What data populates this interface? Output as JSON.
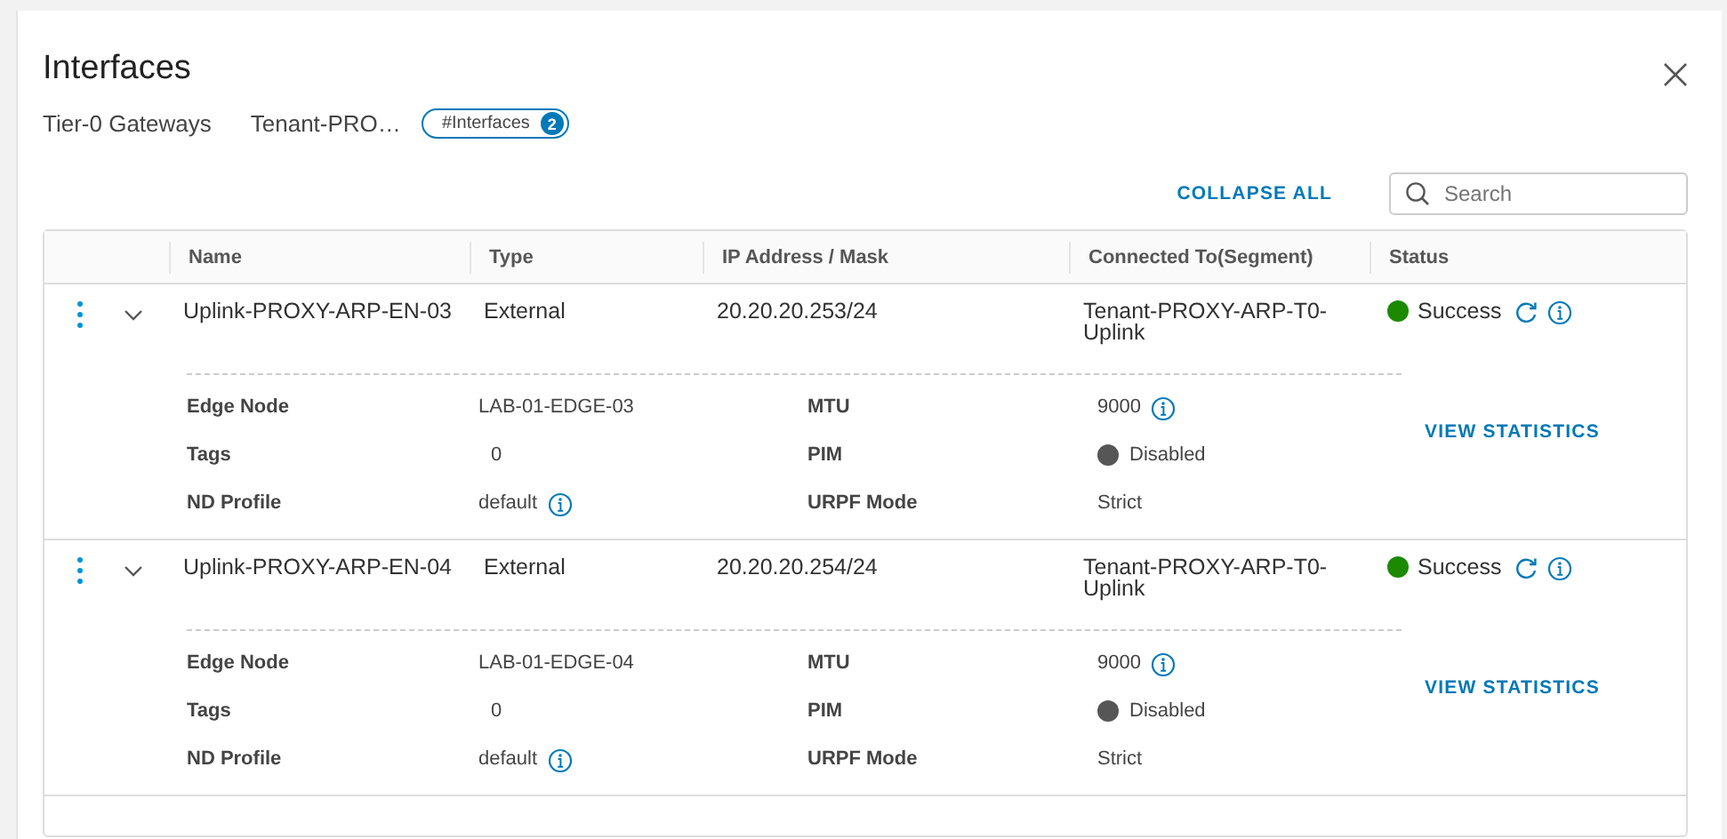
{
  "dialog": {
    "title": "Interfaces"
  },
  "breadcrumb": [
    "Tier-0 Gateways",
    "Tenant-PRO…"
  ],
  "filter_chip": {
    "label": "#Interfaces",
    "count": "2"
  },
  "toolbar": {
    "collapse_all": "COLLAPSE ALL",
    "search": {
      "placeholder": "Search"
    }
  },
  "table": {
    "columns": [
      "Name",
      "Type",
      "IP Address / Mask",
      "Connected To(Segment)",
      "Status"
    ],
    "rows": [
      {
        "expanded": true,
        "name": "Uplink-PROXY-ARP-EN-03",
        "type": "External",
        "ip": "20.20.20.253/24",
        "segment": "Tenant-PROXY-ARP-T0-Uplink",
        "status": {
          "kind": "success",
          "text": "Success"
        },
        "action": "VIEW STATISTICS",
        "details": [
          {
            "label": "Edge Node",
            "value": "LAB-01-EDGE-03",
            "kind": "text",
            "info": false
          },
          {
            "label": "MTU",
            "value": "9000",
            "kind": "text",
            "info": true
          },
          {
            "label": "Tags",
            "value": "0",
            "kind": "count",
            "info": false
          },
          {
            "label": "PIM",
            "value": "Disabled",
            "kind": "toggle",
            "on": false
          },
          {
            "label": "ND Profile",
            "value": "default",
            "kind": "text",
            "info": true
          },
          {
            "label": "URPF Mode",
            "value": "Strict",
            "kind": "text",
            "info": false
          }
        ]
      },
      {
        "expanded": true,
        "name": "Uplink-PROXY-ARP-EN-04",
        "type": "External",
        "ip": "20.20.20.254/24",
        "segment": "Tenant-PROXY-ARP-T0-Uplink",
        "status": {
          "kind": "success",
          "text": "Success"
        },
        "action": "VIEW STATISTICS",
        "details": [
          {
            "label": "Edge Node",
            "value": "LAB-01-EDGE-04",
            "kind": "text",
            "info": false
          },
          {
            "label": "MTU",
            "value": "9000",
            "kind": "text",
            "info": true
          },
          {
            "label": "Tags",
            "value": "0",
            "kind": "count",
            "info": false
          },
          {
            "label": "PIM",
            "value": "Disabled",
            "kind": "toggle",
            "on": false
          },
          {
            "label": "ND Profile",
            "value": "default",
            "kind": "text",
            "info": true
          },
          {
            "label": "URPF Mode",
            "value": "Strict",
            "kind": "text",
            "info": false
          }
        ]
      }
    ]
  }
}
